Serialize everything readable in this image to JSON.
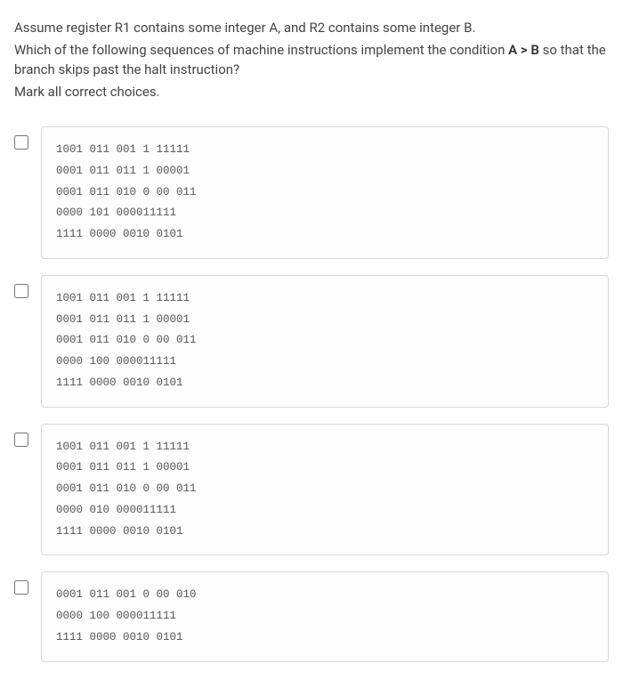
{
  "question": {
    "line1_pre": "Assume register R1 contains some integer A, and R2 contains some integer B.",
    "line2_pre": "Which of the following sequences of machine instructions implement the condition ",
    "line2_bold": "A > B",
    "line2_post": " so that the branch skips past the halt instruction?",
    "line3": "Mark all correct choices."
  },
  "choices": [
    {
      "code": "1001 011 001 1 11111\n0001 011 011 1 00001\n0001 011 010 0 00 011\n0000 101 000011111\n1111 0000 0010 0101"
    },
    {
      "code": "1001 011 001 1 11111\n0001 011 011 1 00001\n0001 011 010 0 00 011\n0000 100 000011111\n1111 0000 0010 0101"
    },
    {
      "code": "1001 011 001 1 11111\n0001 011 011 1 00001\n0001 011 010 0 00 011\n0000 010 000011111\n1111 0000 0010 0101"
    },
    {
      "code": "0001 011 001 0 00 010\n0000 100 000011111\n1111 0000 0010 0101"
    }
  ]
}
